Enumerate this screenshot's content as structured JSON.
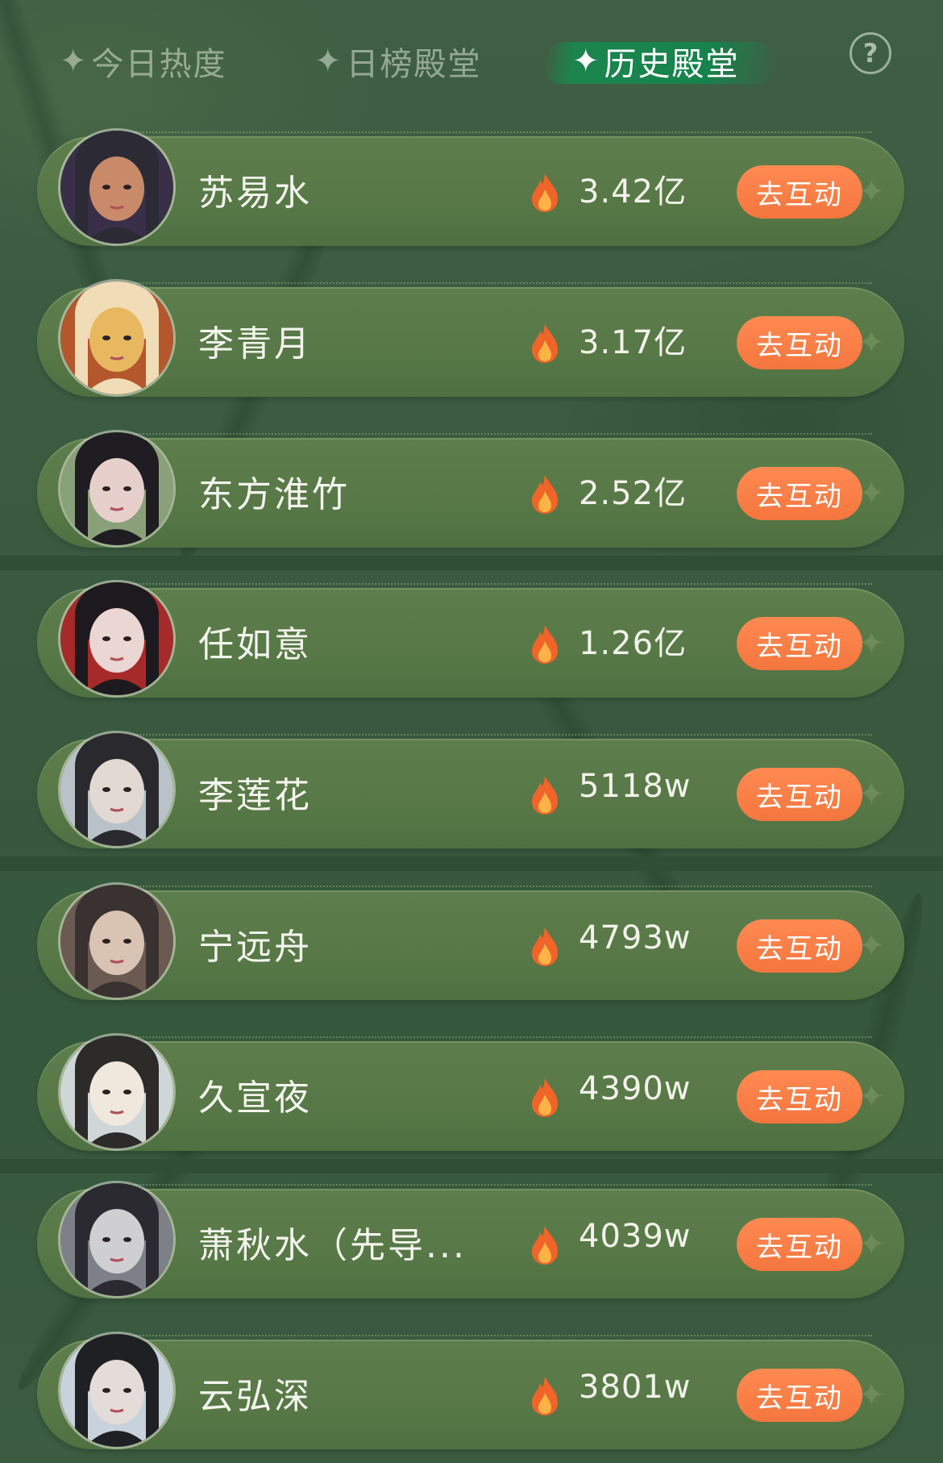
{
  "tabs": [
    {
      "label": "今日热度",
      "active": false
    },
    {
      "label": "日榜殿堂",
      "active": false
    },
    {
      "label": "历史殿堂",
      "active": true
    }
  ],
  "help_icon": "question-circle-icon",
  "tab_sparkle": "✦",
  "button_label": "去互动",
  "colors": {
    "accent_button": "#f47a42",
    "row_bg": "#587947",
    "page_bg": "#3a5a40"
  },
  "rows": [
    {
      "name": "苏易水",
      "heat": "3.42亿"
    },
    {
      "name": "李青月",
      "heat": "3.17亿"
    },
    {
      "name": "东方淮竹",
      "heat": "2.52亿"
    },
    {
      "name": "任如意",
      "heat": "1.26亿"
    },
    {
      "name": "李莲花",
      "heat": "5118w"
    },
    {
      "name": "宁远舟",
      "heat": "4793w"
    },
    {
      "name": "久宣夜",
      "heat": "4390w"
    },
    {
      "name": "萧秋水（先导...",
      "heat": "4039w"
    },
    {
      "name": "云弘深",
      "heat": "3801w"
    }
  ]
}
